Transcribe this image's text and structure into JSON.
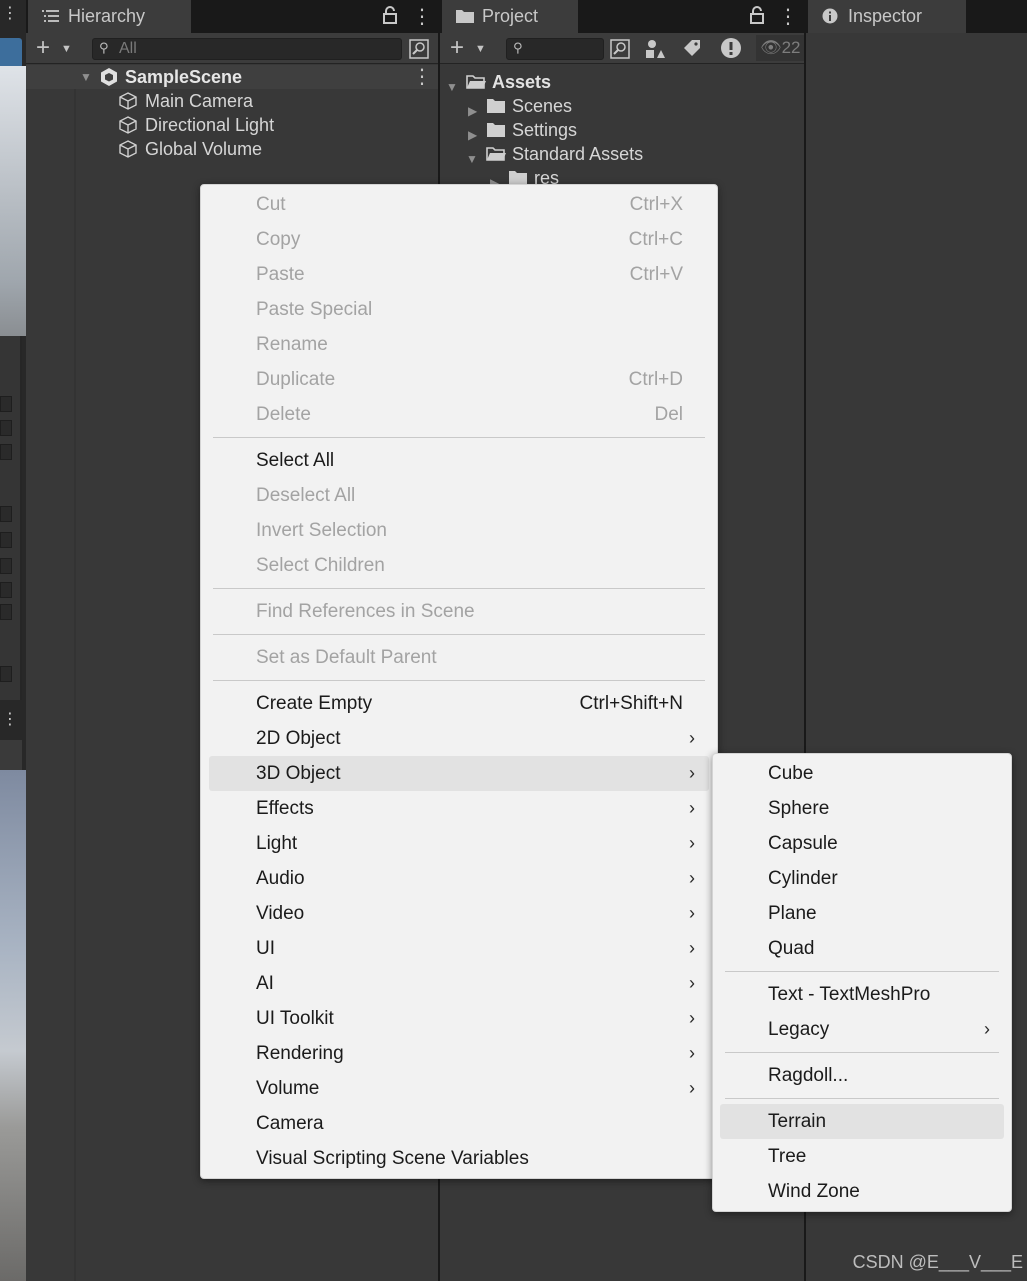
{
  "hierarchy": {
    "tab_label": "Hierarchy",
    "search_placeholder": "All",
    "scene_name": "SampleScene",
    "objects": [
      "Main Camera",
      "Directional Light",
      "Global Volume"
    ]
  },
  "project": {
    "tab_label": "Project",
    "hidden_count": "22",
    "tree": {
      "root": "Assets",
      "children": [
        "Scenes",
        "Settings",
        "Standard Assets"
      ],
      "nested": "res"
    }
  },
  "inspector": {
    "tab_label": "Inspector"
  },
  "context_menu": {
    "items": [
      {
        "label": "Cut",
        "shortcut": "Ctrl+X"
      },
      {
        "label": "Copy",
        "shortcut": "Ctrl+C"
      },
      {
        "label": "Paste",
        "shortcut": "Ctrl+V"
      },
      {
        "label": "Paste Special",
        "shortcut": ""
      },
      {
        "label": "Rename",
        "shortcut": ""
      },
      {
        "label": "Duplicate",
        "shortcut": "Ctrl+D"
      },
      {
        "label": "Delete",
        "shortcut": "Del"
      },
      {
        "label": "Select All",
        "shortcut": ""
      },
      {
        "label": "Deselect All",
        "shortcut": ""
      },
      {
        "label": "Invert Selection",
        "shortcut": ""
      },
      {
        "label": "Select Children",
        "shortcut": ""
      },
      {
        "label": "Find References in Scene",
        "shortcut": ""
      },
      {
        "label": "Set as Default Parent",
        "shortcut": ""
      },
      {
        "label": "Create Empty",
        "shortcut": "Ctrl+Shift+N"
      },
      {
        "label": "2D Object",
        "shortcut": ""
      },
      {
        "label": "3D Object",
        "shortcut": ""
      },
      {
        "label": "Effects",
        "shortcut": ""
      },
      {
        "label": "Light",
        "shortcut": ""
      },
      {
        "label": "Audio",
        "shortcut": ""
      },
      {
        "label": "Video",
        "shortcut": ""
      },
      {
        "label": "UI",
        "shortcut": ""
      },
      {
        "label": "AI",
        "shortcut": ""
      },
      {
        "label": "UI Toolkit",
        "shortcut": ""
      },
      {
        "label": "Rendering",
        "shortcut": ""
      },
      {
        "label": "Volume",
        "shortcut": ""
      },
      {
        "label": "Camera",
        "shortcut": ""
      },
      {
        "label": "Visual Scripting Scene Variables",
        "shortcut": ""
      }
    ],
    "submenu_arrow": "›"
  },
  "submenu_3d_object": {
    "items": [
      "Cube",
      "Sphere",
      "Capsule",
      "Cylinder",
      "Plane",
      "Quad",
      "Text - TextMeshPro",
      "Legacy",
      "Ragdoll...",
      "Terrain",
      "Tree",
      "Wind Zone"
    ]
  },
  "watermark": "CSDN @E___V___E",
  "colors": {
    "panel_bg": "#383838",
    "tab_bar": "#191919",
    "menu_bg": "#f2f2f2",
    "menu_disabled_text": "#a3a3a3",
    "menu_highlight": "#e2e2e2"
  }
}
